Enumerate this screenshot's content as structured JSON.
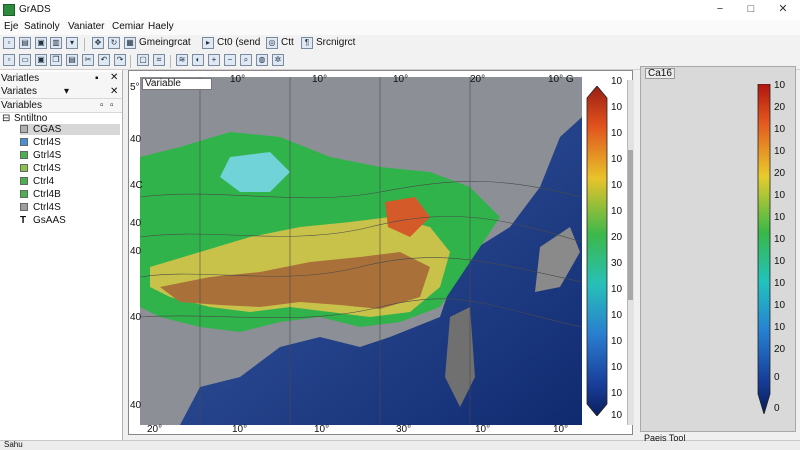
{
  "window": {
    "title": "GrADS",
    "min": "−",
    "max": "□",
    "close": "✕"
  },
  "menu": [
    "Eje",
    "Satinoly",
    "Vaniater",
    "Cemiar",
    "Haely"
  ],
  "toolbar1": {
    "item1": "Gmeingrcat",
    "item2": "Ct0 (send",
    "item3": "Ctt",
    "item4": "Srcnigrct"
  },
  "left": {
    "header1": "Variatles",
    "header2": "Variates",
    "header3": "Variables",
    "tree_root": "Sntiltno",
    "items": [
      {
        "label": "CGAS",
        "color": "#b0b0b0"
      },
      {
        "label": "Ctrl4S",
        "color": "#4a90d9"
      },
      {
        "label": "Gtrl4S",
        "color": "#4caf50"
      },
      {
        "label": "Ctrl4S",
        "color": "#8bc34a"
      },
      {
        "label": "Ctrl4",
        "color": "#4caf50"
      },
      {
        "label": "Ctrl4B",
        "color": "#4caf50"
      },
      {
        "label": "Ctrl4S",
        "color": "#9e9e9e"
      },
      {
        "label": "GsAAS",
        "color": "#555555"
      }
    ]
  },
  "map": {
    "variable_tab": "Variable",
    "top_ticks": [
      "10°",
      "10°",
      "10°",
      "20°",
      "10°"
    ],
    "bottom_ticks": [
      "20°",
      "10°",
      "10°",
      "30°",
      "10°",
      "10°"
    ],
    "left_ticks": [
      "5°",
      "40",
      "4C",
      "40",
      "40",
      "40",
      "40"
    ],
    "corner_label": "10° G",
    "colorbar_ticks": [
      "10",
      "10",
      "10",
      "10",
      "10",
      "10",
      "20",
      "30",
      "10",
      "10",
      "10",
      "10",
      "10",
      "10"
    ]
  },
  "right": {
    "tab": "Ca16",
    "colorbar_ticks": [
      "10",
      "20",
      "10",
      "10",
      "20",
      "10",
      "10",
      "10",
      "10",
      "10",
      "10",
      "10",
      "20",
      "0",
      "0"
    ]
  },
  "status": {
    "left": "Sahu",
    "right": "Paeis Tool"
  }
}
